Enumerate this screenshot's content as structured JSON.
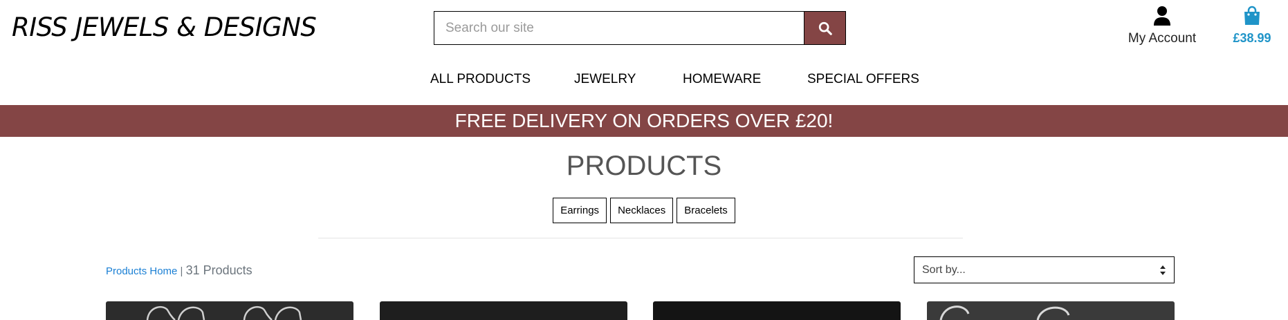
{
  "header": {
    "logo_text": "RISS JEWELS & DESIGNS",
    "search": {
      "placeholder": "Search our site",
      "button_icon": "search-icon"
    },
    "account": {
      "label": "My Account",
      "icon": "user-icon"
    },
    "cart": {
      "amount": "£38.99",
      "icon": "shopping-bag-icon"
    }
  },
  "nav": {
    "items": [
      {
        "label": "ALL PRODUCTS"
      },
      {
        "label": "JEWELRY"
      },
      {
        "label": "HOMEWARE"
      },
      {
        "label": "SPECIAL OFFERS"
      }
    ]
  },
  "banner": {
    "text": "FREE DELIVERY ON ORDERS OVER £20!"
  },
  "main": {
    "title": "PRODUCTS",
    "categories": [
      "Earrings",
      "Necklaces",
      "Bracelets"
    ],
    "breadcrumb": {
      "home": "Products Home",
      "separator": "|",
      "count": "31 Products"
    },
    "sort": {
      "selected": "Sort by..."
    }
  },
  "colors": {
    "brand": "#844545",
    "accent": "#1f94c8",
    "link": "#1a7fd4"
  }
}
